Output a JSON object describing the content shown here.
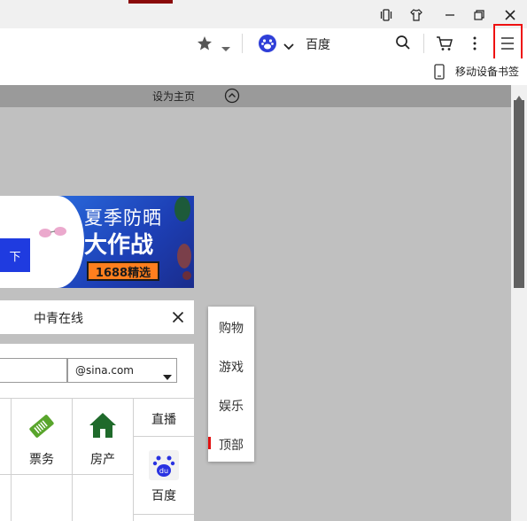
{
  "browser": {
    "search_engine_label": "百度",
    "bookmark_mobile_label": "移动设备书签",
    "set_homepage_label": "设为主页"
  },
  "banner": {
    "headline": "夏季防晒",
    "subline": "大作战",
    "tag": "1688精选",
    "left_button_label": "下"
  },
  "panel": {
    "title": "中青在线",
    "email_domain": "@sina.com",
    "tiles": [
      {
        "label": "票务",
        "icon": "ticket-icon"
      },
      {
        "label": "房产",
        "icon": "house-icon"
      }
    ],
    "side_items": [
      {
        "label": "直播"
      },
      {
        "label": "百度",
        "icon": "baidu-icon"
      }
    ]
  },
  "popup_menu": {
    "items": [
      "购物",
      "游戏",
      "娱乐",
      "顶部"
    ],
    "active_index": 3
  },
  "colors": {
    "accent_red": "#e11111",
    "banner_blue": "#1d3fb5",
    "banner_tag_bg": "#ff7f1e",
    "house_green": "#1f6a2b",
    "ticket_green": "#59a52c"
  }
}
